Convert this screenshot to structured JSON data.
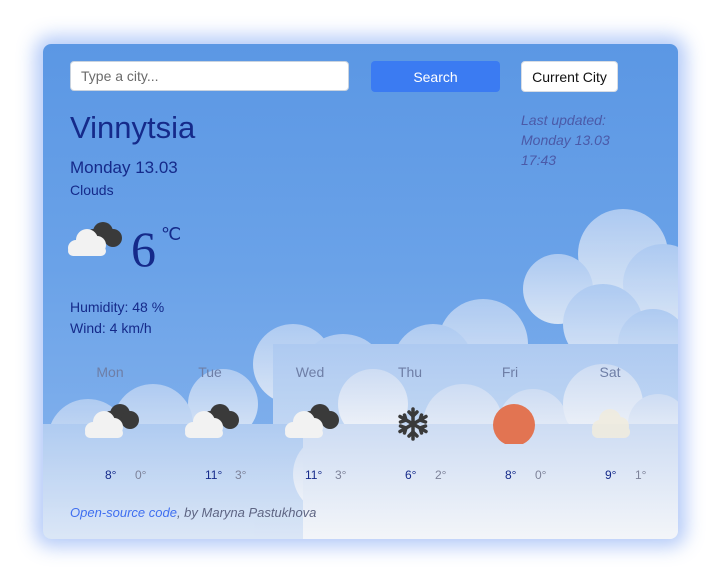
{
  "search": {
    "placeholder": "Type a city...",
    "button_label": "Search",
    "current_city_label": "Current City"
  },
  "current": {
    "city": "Vinnytsia",
    "date": "Monday 13.03",
    "description": "Clouds",
    "temperature": "6",
    "unit": "℃",
    "humidity": "Humidity: 48 %",
    "wind": "Wind: 4 km/h",
    "icon": "cloud-icon"
  },
  "last_updated": {
    "label": "Last updated:",
    "date": "Monday 13.03",
    "time": "17:43"
  },
  "forecast": [
    {
      "day": "Mon",
      "max": "8°",
      "min": "0°",
      "icon": "cloud-icon"
    },
    {
      "day": "Tue",
      "max": "11°",
      "min": "3°",
      "icon": "cloud-icon"
    },
    {
      "day": "Wed",
      "max": "11°",
      "min": "3°",
      "icon": "cloud-icon"
    },
    {
      "day": "Thu",
      "max": "6°",
      "min": "2°",
      "icon": "snowflake-icon"
    },
    {
      "day": "Fri",
      "max": "8°",
      "min": "0°",
      "icon": "sun-icon"
    },
    {
      "day": "Sat",
      "max": "9°",
      "min": "1°",
      "icon": "light-cloud-icon"
    }
  ],
  "footer": {
    "link_text": "Open-source code",
    "credit": ", by Maryna Pastukhova"
  },
  "colors": {
    "card_bg": "#5b97e4",
    "accent": "#3b7bf2",
    "text": "#152a8a"
  }
}
